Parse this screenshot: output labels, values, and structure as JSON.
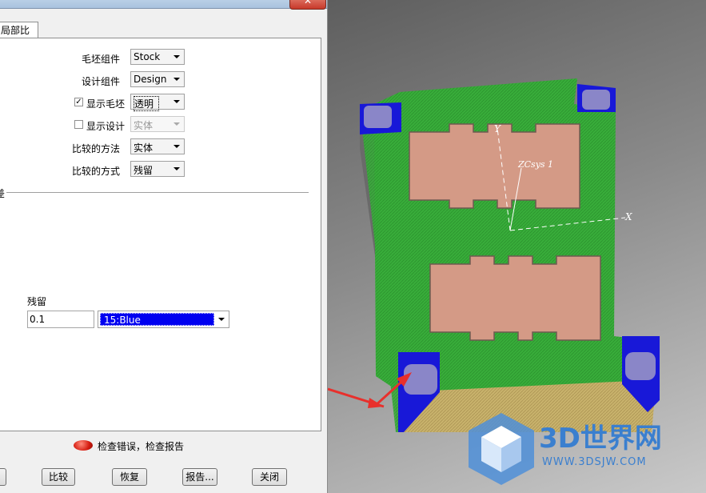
{
  "dialog": {
    "close_label": "✕",
    "tab_label": "局部比较",
    "fields": {
      "stock_component": {
        "label": "毛坯组件",
        "value": "Stock"
      },
      "design_component": {
        "label": "设计组件",
        "value": "Design"
      },
      "show_stock": {
        "label": "显示毛坯",
        "checked": true,
        "value": "透明"
      },
      "show_design": {
        "label": "显示设计",
        "checked": false,
        "value": "实体"
      },
      "compare_method": {
        "label": "比较的方法",
        "value": "实体"
      },
      "compare_mode": {
        "label": "比较的方式",
        "value": "残留"
      }
    },
    "section_fragment": "差",
    "residual": {
      "label": "残留",
      "value": "0.1",
      "color_value": "15:Blue",
      "color_hex": "#0000f0"
    },
    "status_text": "检查错误，检查报告",
    "buttons": {
      "compare": "比较",
      "restore": "恢复",
      "report": "报告...",
      "close": "关闭"
    }
  },
  "viewport": {
    "axis_x": "X",
    "axis_y": "Y",
    "csys_label": "ZCsys 1",
    "logo_text": "3D世界网",
    "logo_url": "WWW.3DSJW.COM",
    "colors": {
      "top_face": "#33a836",
      "side_face": "#c9b06a",
      "cavity": "#d69b86",
      "residual": "#1010d0"
    }
  }
}
